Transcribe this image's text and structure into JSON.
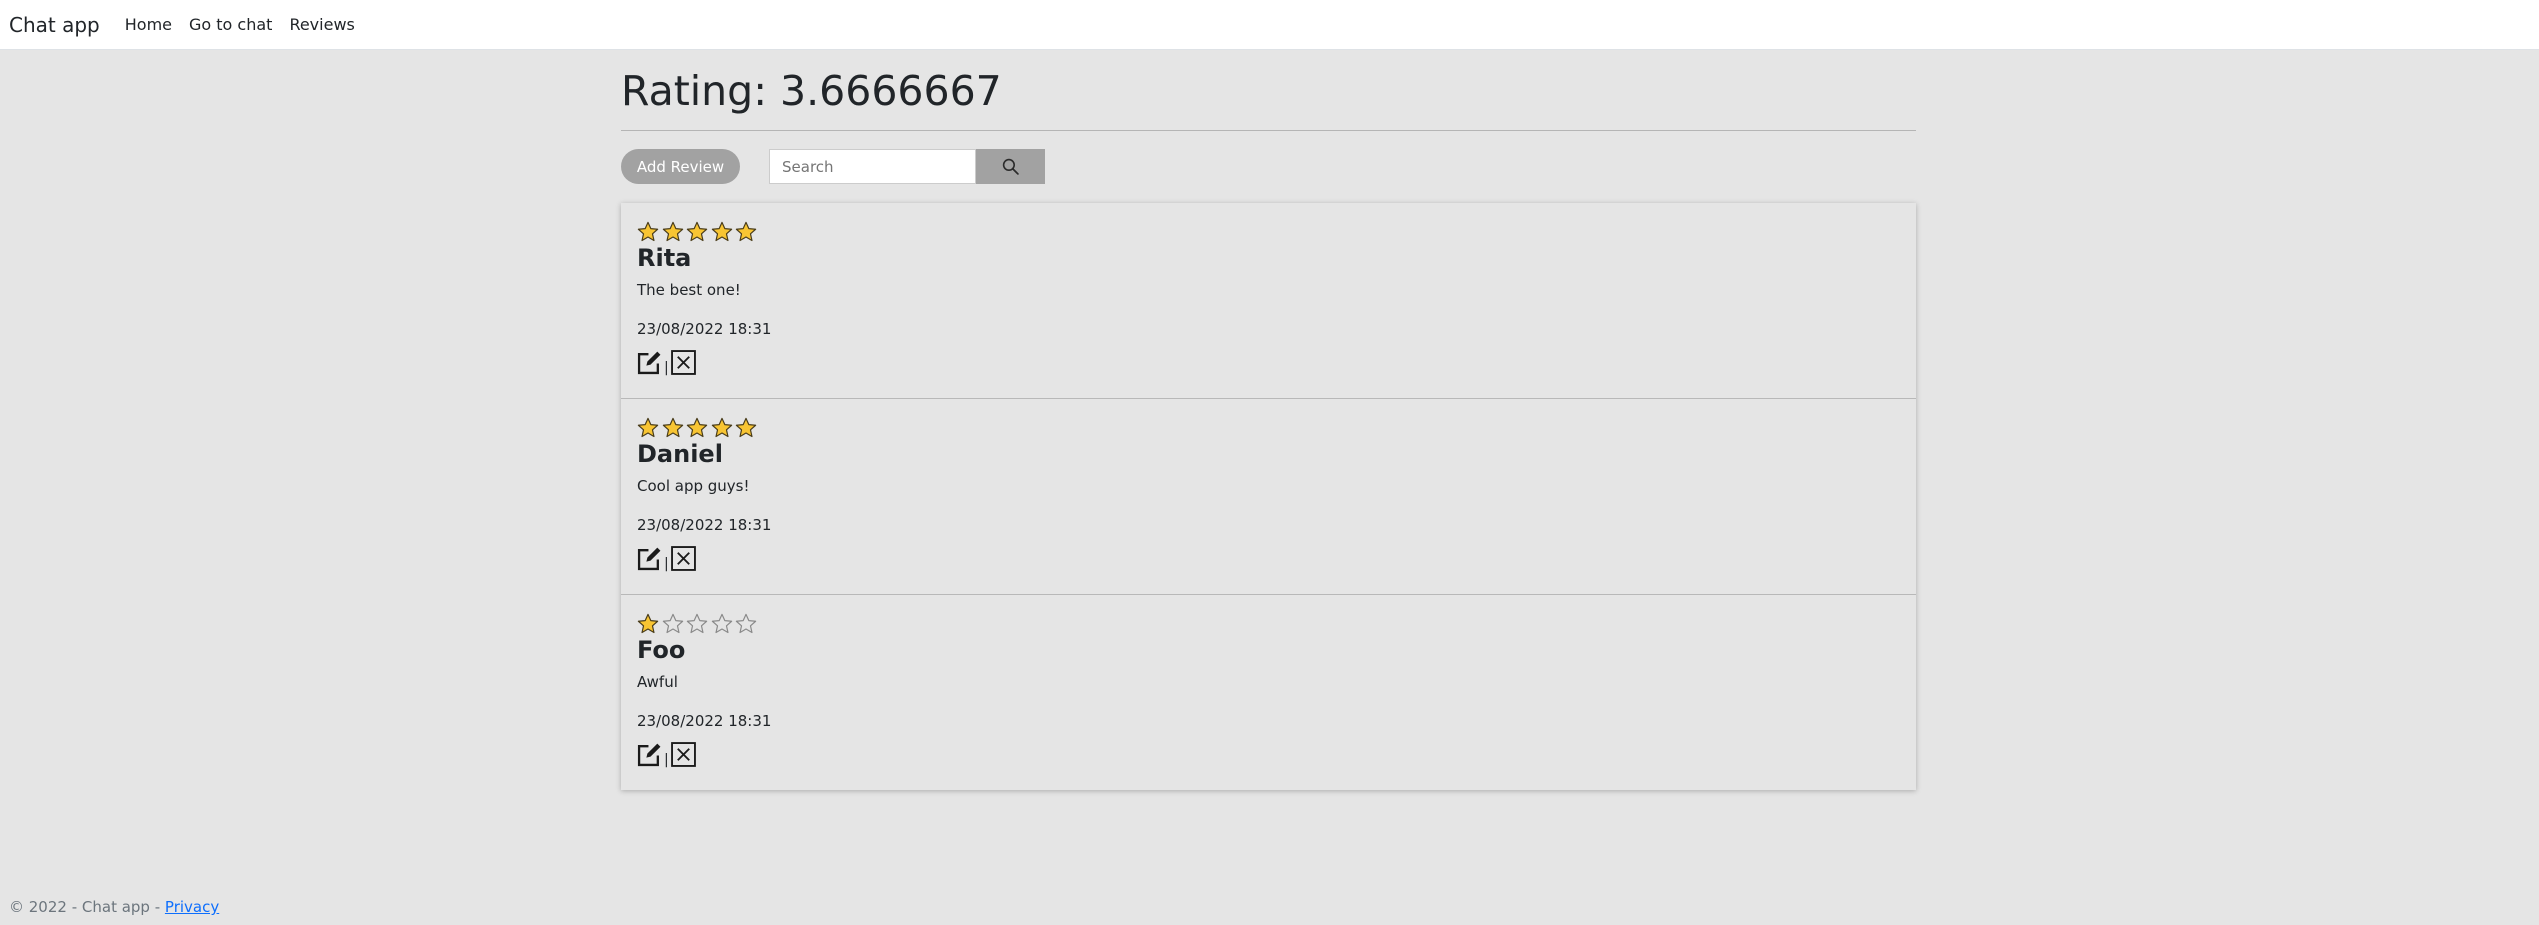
{
  "navbar": {
    "brand": "Chat app",
    "links": [
      "Home",
      "Go to chat",
      "Reviews"
    ]
  },
  "page": {
    "title": "Rating: 3.6666667",
    "add_review_label": "Add Review",
    "search_placeholder": "Search"
  },
  "reviews": [
    {
      "stars": 5,
      "name": "Rita",
      "text": "The best one!",
      "date": "23/08/2022 18:31"
    },
    {
      "stars": 5,
      "name": "Daniel",
      "text": "Cool app guys!",
      "date": "23/08/2022 18:31"
    },
    {
      "stars": 1,
      "name": "Foo",
      "text": "Awful",
      "date": "23/08/2022 18:31"
    }
  ],
  "icons": {
    "star_filled": "star-filled-icon",
    "star_empty": "star-empty-icon",
    "edit": "edit-icon",
    "delete": "delete-icon",
    "search": "search-icon"
  },
  "colors": {
    "star_fill": "#f8c533",
    "button_gray": "#a2a2a2",
    "background": "#e5e5e5",
    "link": "#0d6efd"
  },
  "review_separator": "|",
  "footer": {
    "text": "© 2022 - Chat app - ",
    "privacy_label": "Privacy"
  }
}
